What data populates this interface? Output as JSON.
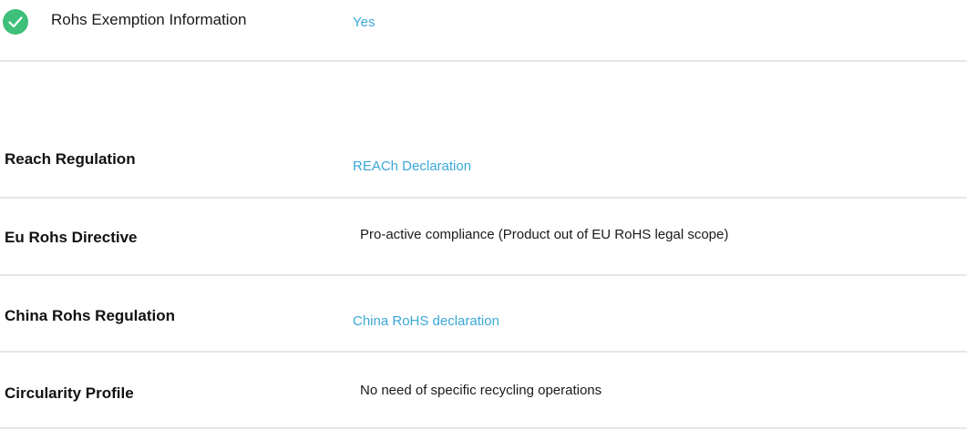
{
  "rohs_exemption": {
    "icon": "check-circle-icon",
    "label": "Rohs Exemption Information",
    "value": "Yes"
  },
  "rows": [
    {
      "label": "Reach Regulation",
      "value": "REACh Declaration",
      "is_link": true
    },
    {
      "label": "Eu Rohs Directive",
      "value": "Pro-active compliance (Product out of EU RoHS legal scope)",
      "is_link": false
    },
    {
      "label": "China Rohs Regulation",
      "value": "China RoHS declaration",
      "is_link": true
    },
    {
      "label": "Circularity Profile",
      "value": "No need of specific recycling operations",
      "is_link": false
    }
  ],
  "colors": {
    "accent_link": "#3aa7d8",
    "check_green": "#3ec07a",
    "divider": "#e6e6e6"
  }
}
